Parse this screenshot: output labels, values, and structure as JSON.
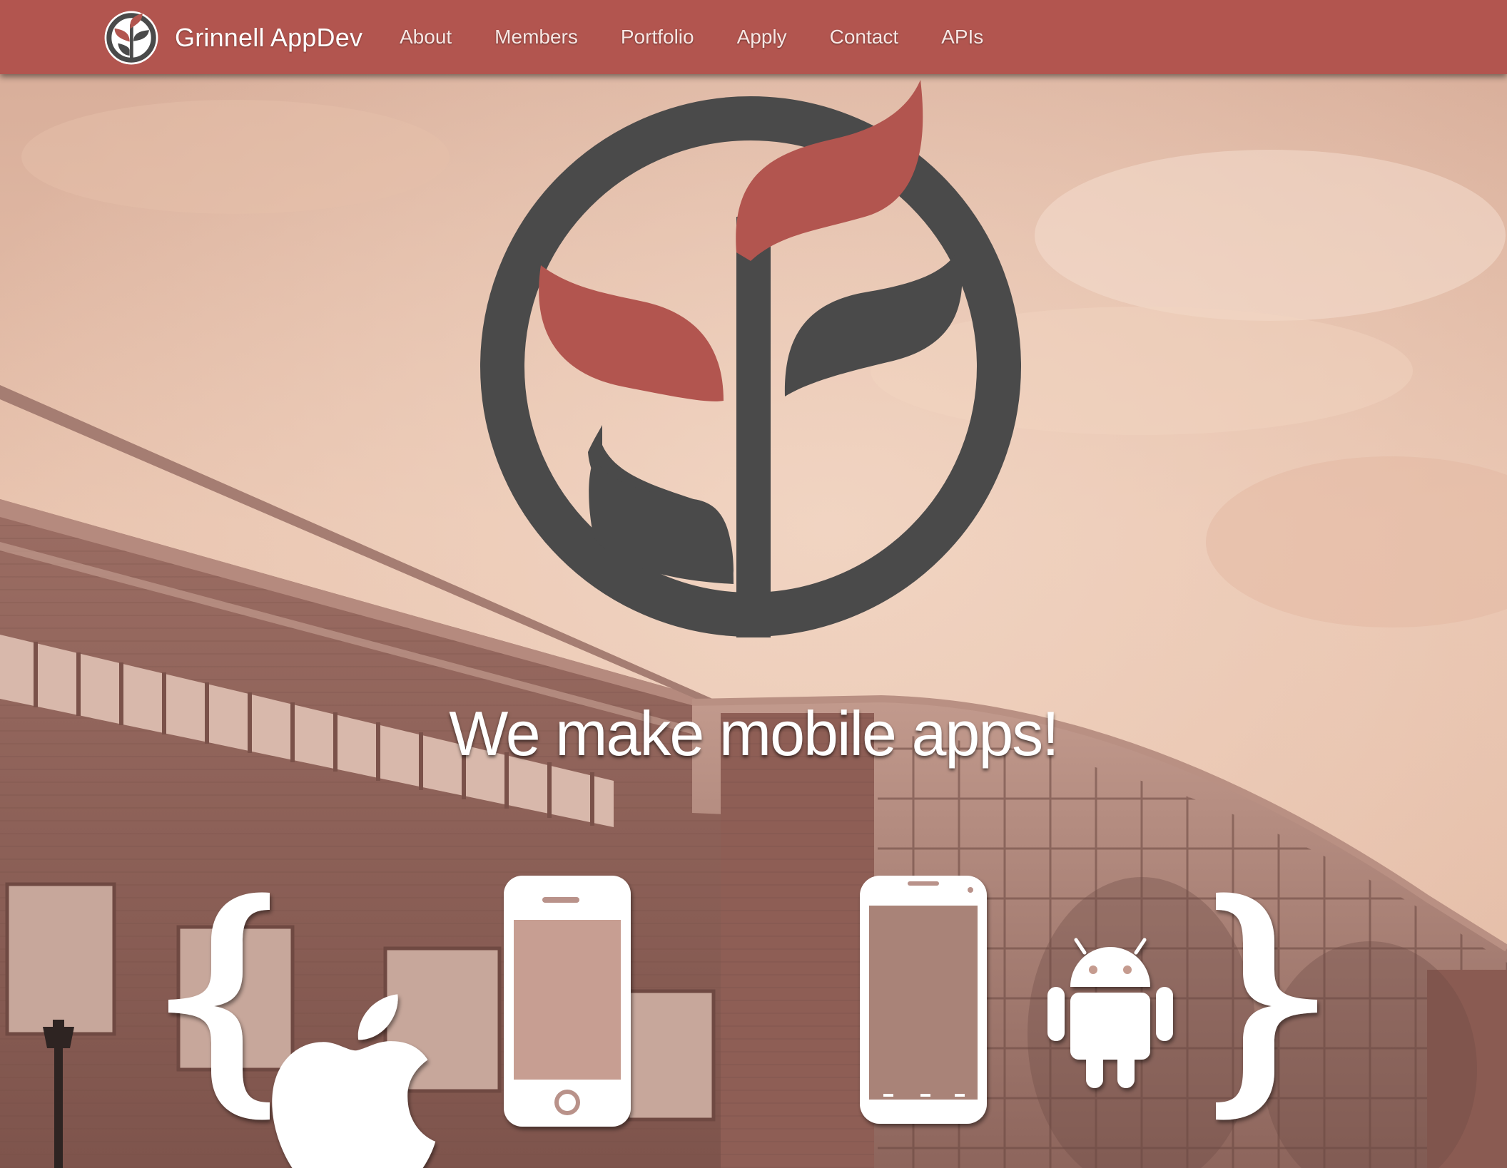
{
  "site": {
    "title": "Grinnell AppDev"
  },
  "navbar": {
    "brand": {
      "label": "Grinnell AppDev",
      "icon": "appdev-logo-icon"
    },
    "links": [
      {
        "label": "About"
      },
      {
        "label": "Members"
      },
      {
        "label": "Portfolio"
      },
      {
        "label": "Apply"
      },
      {
        "label": "Contact"
      },
      {
        "label": "APIs"
      }
    ]
  },
  "hero": {
    "tagline": "We make mobile apps!",
    "logo_icon": "appdev-sprout-logo-icon",
    "icons": [
      "left-brace-icon",
      "apple-icon",
      "iphone-icon",
      "android-phone-icon",
      "android-robot-icon",
      "right-brace-icon"
    ]
  },
  "colors": {
    "brand_red": "#b2554f",
    "logo_gray": "#4a4a4a",
    "nav_text": "#f7e7e4",
    "icon_white": "#ffffff"
  }
}
